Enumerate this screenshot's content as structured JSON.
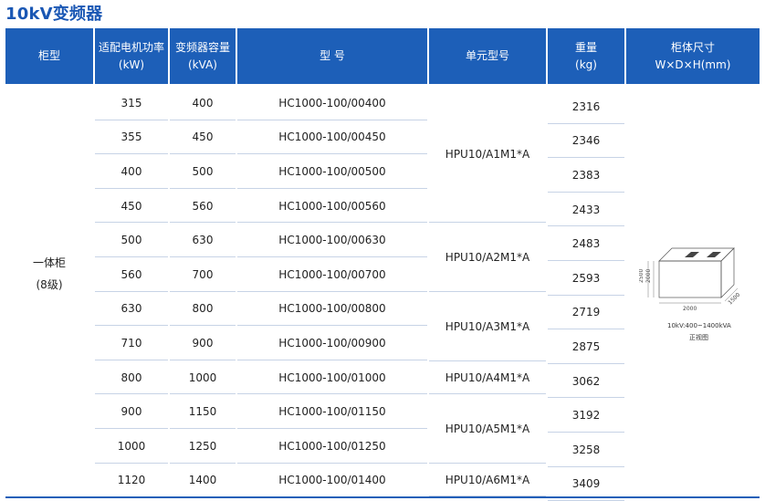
{
  "title": "10kV变频器",
  "headers": {
    "cabinet_type": "柜型",
    "motor_power": [
      "适配电机功率",
      "(kW)"
    ],
    "capacity": [
      "变频器容量",
      "(kVA)"
    ],
    "model": "型 号",
    "unit_model": "单元型号",
    "weight": [
      "重量",
      "(kg)"
    ],
    "dimensions": [
      "柜体尺寸",
      "W×D×H(mm)"
    ]
  },
  "cabinet_type": [
    "一体柜",
    "(8级)"
  ],
  "rows": [
    {
      "power": "315",
      "capacity": "400",
      "model": "HC1000-100/00400",
      "weight": "2316"
    },
    {
      "power": "355",
      "capacity": "450",
      "model": "HC1000-100/00450",
      "weight": "2346"
    },
    {
      "power": "400",
      "capacity": "500",
      "model": "HC1000-100/00500",
      "weight": "2383"
    },
    {
      "power": "450",
      "capacity": "560",
      "model": "HC1000-100/00560",
      "weight": "2433"
    },
    {
      "power": "500",
      "capacity": "630",
      "model": "HC1000-100/00630",
      "weight": "2483"
    },
    {
      "power": "560",
      "capacity": "700",
      "model": "HC1000-100/00700",
      "weight": "2593"
    },
    {
      "power": "630",
      "capacity": "800",
      "model": "HC1000-100/00800",
      "weight": "2719"
    },
    {
      "power": "710",
      "capacity": "900",
      "model": "HC1000-100/00900",
      "weight": "2875"
    },
    {
      "power": "800",
      "capacity": "1000",
      "model": "HC1000-100/01000",
      "weight": "3062"
    },
    {
      "power": "900",
      "capacity": "1150",
      "model": "HC1000-100/01150",
      "weight": "3192"
    },
    {
      "power": "1000",
      "capacity": "1250",
      "model": "HC1000-100/01250",
      "weight": "3258"
    },
    {
      "power": "1120",
      "capacity": "1400",
      "model": "HC1000-100/01400",
      "weight": "3409"
    }
  ],
  "unit_models": [
    "HPU10/A1M1*A",
    "HPU10/A2M1*A",
    "HPU10/A3M1*A",
    "HPU10/A4M1*A",
    "HPU10/A5M1*A",
    "HPU10/A6M1*A"
  ],
  "diagram": {
    "dim_height": "2500",
    "dim_depth_side": "2000",
    "dim_width": "2000",
    "dim_depth": "1500",
    "caption_range": "10kV:400~1400kVA",
    "caption_view": "正视图"
  }
}
